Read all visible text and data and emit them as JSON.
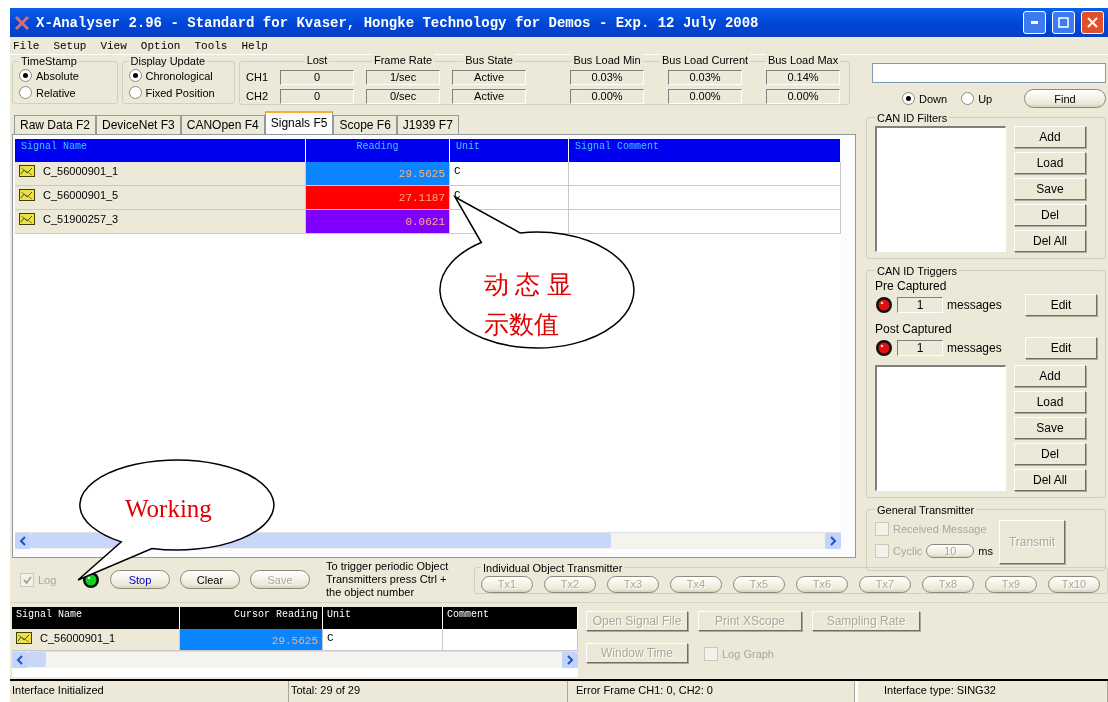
{
  "window": {
    "title": "X-Analyser 2.96 - Standard for Kvaser, Hongke Technology for Demos - Exp. 12 July 2008"
  },
  "menu": [
    "File",
    "Setup",
    "View",
    "Option",
    "Tools",
    "Help"
  ],
  "timestamp": {
    "title": "TimeStamp",
    "options": [
      {
        "label": "Absolute",
        "selected": true
      },
      {
        "label": "Relative",
        "selected": false
      }
    ]
  },
  "display_update": {
    "title": "Display Update",
    "options": [
      {
        "label": "Chronological",
        "selected": true
      },
      {
        "label": "Fixed Position",
        "selected": false
      }
    ]
  },
  "bus_stats": {
    "columns": [
      "Lost",
      "Frame Rate",
      "Bus State",
      "Bus Load Min",
      "Bus Load Current",
      "Bus Load Max"
    ],
    "rows": [
      {
        "channel": "CH1",
        "values": [
          "0",
          "1/sec",
          "Active",
          "0.03%",
          "0.03%",
          "0.14%"
        ]
      },
      {
        "channel": "CH2",
        "values": [
          "0",
          "0/sec",
          "Active",
          "0.00%",
          "0.00%",
          "0.00%"
        ]
      }
    ]
  },
  "search": {
    "directions": [
      {
        "label": "Down",
        "selected": true
      },
      {
        "label": "Up",
        "selected": false
      }
    ],
    "find_button": "Find"
  },
  "tabs": [
    {
      "label": "Raw Data F2",
      "selected": false
    },
    {
      "label": "DeviceNet F3",
      "selected": false
    },
    {
      "label": "CANOpen F4",
      "selected": false
    },
    {
      "label": "Signals F5",
      "selected": true
    },
    {
      "label": "Scope F6",
      "selected": false
    },
    {
      "label": "J1939 F7",
      "selected": false
    }
  ],
  "signals_table": {
    "columns": [
      "Signal Name",
      "Reading",
      "Unit",
      "Signal Comment"
    ],
    "rows": [
      {
        "name": "C_56000901_1",
        "reading": "29.5625",
        "color": "#0a84ff",
        "unit": "C"
      },
      {
        "name": "C_56000901_5",
        "reading": "27.1187",
        "color": "#ff0000",
        "unit": "C"
      },
      {
        "name": "C_51900257_3",
        "reading": "0.0621",
        "color": "#8000ff"
      }
    ]
  },
  "can_id_filters": {
    "title": "CAN ID Filters",
    "buttons": [
      "Add",
      "Load",
      "Save",
      "Del",
      "Del All"
    ]
  },
  "can_id_triggers": {
    "title": "CAN ID Triggers",
    "captures": [
      {
        "label": "Pre Captured",
        "count": "1",
        "unit": "messages",
        "button": "Edit"
      },
      {
        "label": "Post Captured",
        "count": "1",
        "unit": "messages",
        "button": "Edit"
      }
    ],
    "buttons": [
      "Add",
      "Load",
      "Save",
      "Del",
      "Del All"
    ]
  },
  "general_transmitter": {
    "title": "General Transmitter",
    "disabled": true,
    "received_message": {
      "label": "Received Message",
      "checked": false
    },
    "cyclic": {
      "label": "Cyclic",
      "checked": false,
      "interval": "10",
      "unit": "ms"
    },
    "transmit_button": "Transmit"
  },
  "log": {
    "label": "Log",
    "checked": true,
    "disabled": true
  },
  "controls": [
    {
      "label": "Stop",
      "disabled": false
    },
    {
      "label": "Clear",
      "disabled": false
    },
    {
      "label": "Save",
      "disabled": true
    }
  ],
  "hint": "To trigger periodic Object Transmitters press Ctrl + the object number",
  "object_transmitter": {
    "title": "Individual Object Transmitter",
    "disabled": true,
    "buttons": [
      "Tx1",
      "Tx2",
      "Tx3",
      "Tx4",
      "Tx5",
      "Tx6",
      "Tx7",
      "Tx8",
      "Tx9",
      "Tx10"
    ]
  },
  "cursor_table": {
    "columns": [
      "Signal Name",
      "Cursor Reading",
      "Unit",
      "Comment"
    ],
    "rows": [
      {
        "name": "C_56000901_1",
        "reading": "29.5625",
        "color": "#0a84ff",
        "unit": "C"
      }
    ]
  },
  "scope_buttons": [
    {
      "label": "Open Signal File",
      "disabled": true
    },
    {
      "label": "Print XScope",
      "disabled": true
    },
    {
      "label": "Sampling Rate",
      "disabled": true
    },
    {
      "label": "Window Time",
      "disabled": true
    }
  ],
  "log_graph": {
    "label": "Log Graph",
    "checked": false,
    "disabled": true
  },
  "status_bar": [
    "Interface Initialized",
    "Total: 29 of 29",
    "Error Frame  CH1: 0, CH2: 0",
    "Interface type: SING32"
  ],
  "callouts": [
    {
      "lines": [
        "动 态 显",
        "示数值"
      ]
    },
    {
      "lines": [
        "Working"
      ]
    }
  ]
}
